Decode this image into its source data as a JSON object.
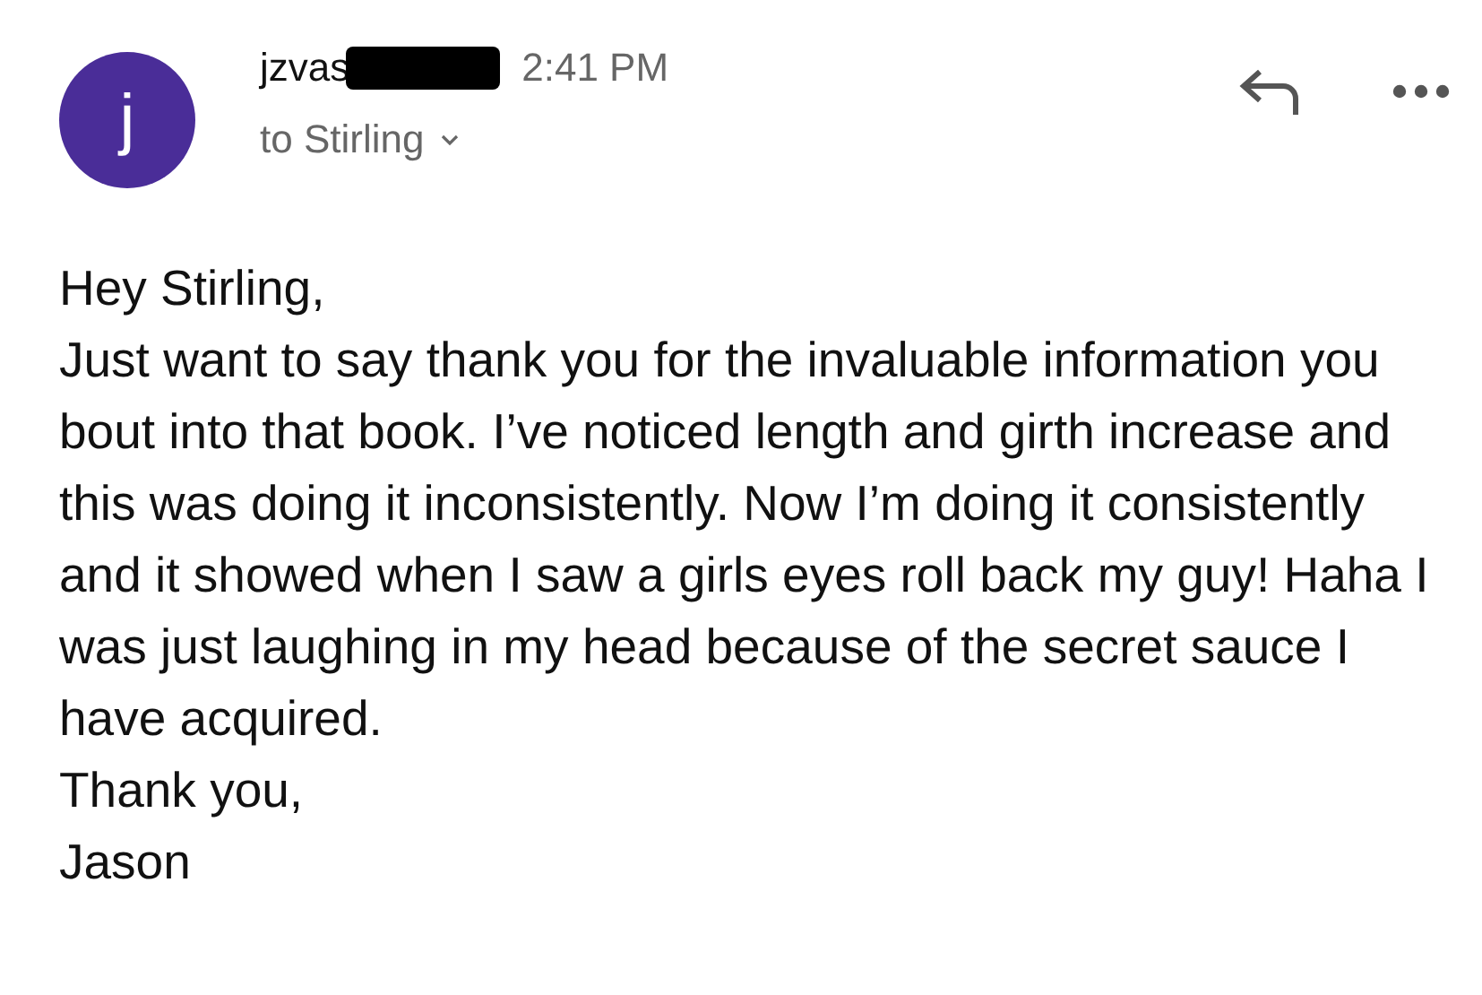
{
  "message": {
    "avatar_letter": "j",
    "sender": "jzvas",
    "sender_redacted": true,
    "time": "2:41 PM",
    "recipient": "to Stirling",
    "body": [
      "Hey Stirling,",
      "Just want to say thank you for the invaluable information you bout into that book. I’ve noticed length and girth increase and this was doing it inconsistently. Now I’m doing it consistently and it showed when I saw a girls eyes roll back my guy! Haha I was just laughing in my head because of the secret sauce I have acquired.",
      "Thank you,",
      "Jason"
    ]
  }
}
